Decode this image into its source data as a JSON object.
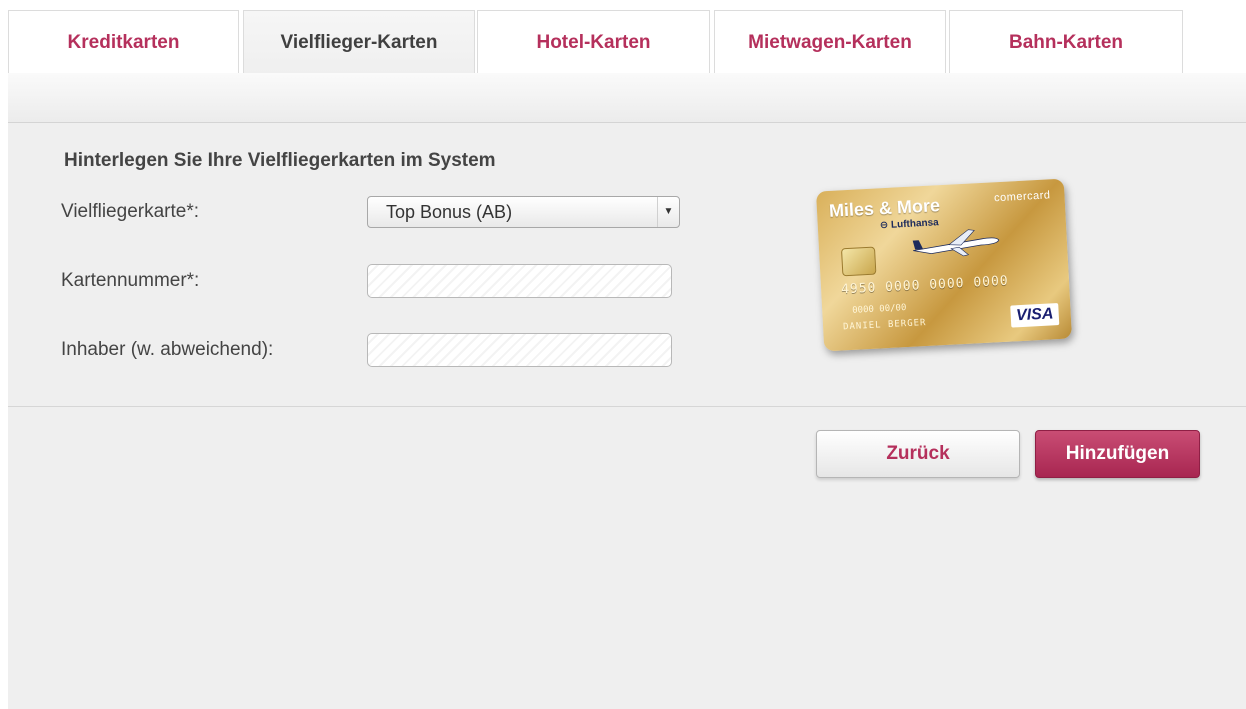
{
  "tabs": [
    {
      "label": "Kreditkarten",
      "active": false
    },
    {
      "label": "Vielflieger-Karten",
      "active": true
    },
    {
      "label": "Hotel-Karten",
      "active": false
    },
    {
      "label": "Mietwagen-Karten",
      "active": false
    },
    {
      "label": "Bahn-Karten",
      "active": false
    }
  ],
  "form": {
    "heading": "Hinterlegen Sie Ihre Vielfliegerkarten im System",
    "card_type_label": "Vielfliegerkarte*:",
    "card_type_value": "Top Bonus (AB)",
    "card_number_label": "Kartennummer*:",
    "card_number_value": "",
    "holder_label": "Inhaber (w. abweichend):",
    "holder_value": ""
  },
  "card_image": {
    "brand": "Miles & More",
    "issuer": "comercard",
    "airline": "Lufthansa",
    "number": "4950 0000 0000 0000",
    "date": "0000 00/00",
    "holder": "DANIEL BERGER",
    "network": "VISA",
    "color": "#d9b05a"
  },
  "buttons": {
    "back_label": "Zurück",
    "add_label": "Hinzufügen"
  },
  "colors": {
    "accent": "#b5305c",
    "primary_button": "#b82f5a"
  }
}
